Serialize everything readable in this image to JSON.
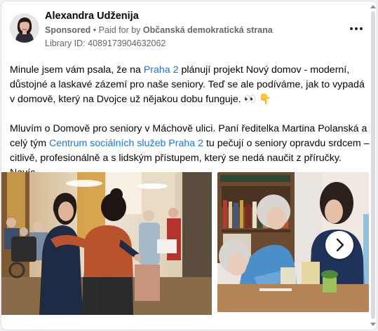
{
  "post": {
    "author_name": "Alexandra Udženija",
    "sponsored_label": "Sponsored",
    "separator": "•",
    "paid_for_prefix": "Paid for by",
    "paid_for_org": "Občanská demokratická strana",
    "library_id": "Library ID: 4089173904632062",
    "more_icon": "more-horizontal-icon",
    "paragraph1": {
      "part1": "Minule jsem vám psala, že na ",
      "link1": "Praha 2",
      "part2": " plánují projekt Nový domov - moderní, důstojné a laskavé zázemí pro naše seniory. Teď se ale podíváme, jak to vypadá v domově, který na Dvojce už nějakou dobu funguje. ",
      "emoji": "👀 👇"
    },
    "paragraph2": {
      "part1": "Mluvím o Domově pro seniory v Máchově ulici. Paní ředitelka Martina Polanská a celý tým ",
      "link1": "Centrum sociálních služeb Praha 2",
      "part2": " tu pečují o seniory opravdu srdcem – citlivě, profesionálně a s lidským přístupem, který se nedá naučit z příručky. Navíc..."
    },
    "carousel": {
      "photo1": "photo-hug-in-senior-home",
      "photo2": "photo-conversation-with-senior",
      "next_icon": "chevron-right-icon"
    }
  },
  "colors": {
    "link": "#1b74e4",
    "secondary_text": "#65676b",
    "card_bg": "#ffffff",
    "page_bg": "#f0f2f5"
  }
}
